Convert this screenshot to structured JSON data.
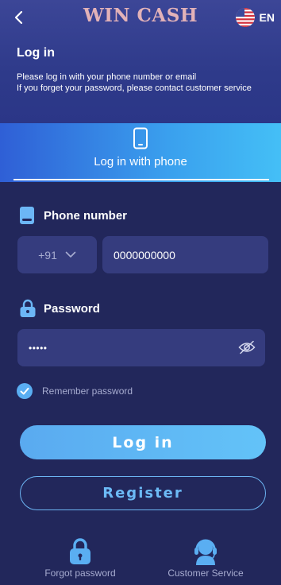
{
  "header": {
    "brand": "WIN CASH",
    "language": "EN",
    "title": "Log in",
    "description_line1": "Please log in with your phone number or email",
    "description_line2": "If you forget your password, please contact customer service"
  },
  "tabs": [
    {
      "label": "Log in with phone",
      "icon": "phone-icon",
      "active": true
    }
  ],
  "form": {
    "phone_label": "Phone number",
    "country_code": "+91",
    "phone_value": "0000000000",
    "password_label": "Password",
    "password_value": "•••••",
    "remember_label": "Remember password",
    "remember_checked": true
  },
  "buttons": {
    "login": "Log in",
    "register": "Register"
  },
  "footer": {
    "forgot": "Forgot password",
    "service": "Customer Service"
  },
  "colors": {
    "background": "#22275b",
    "field": "#353c7e",
    "accent": "#63c3f8",
    "brand": "#e2b2b8"
  }
}
